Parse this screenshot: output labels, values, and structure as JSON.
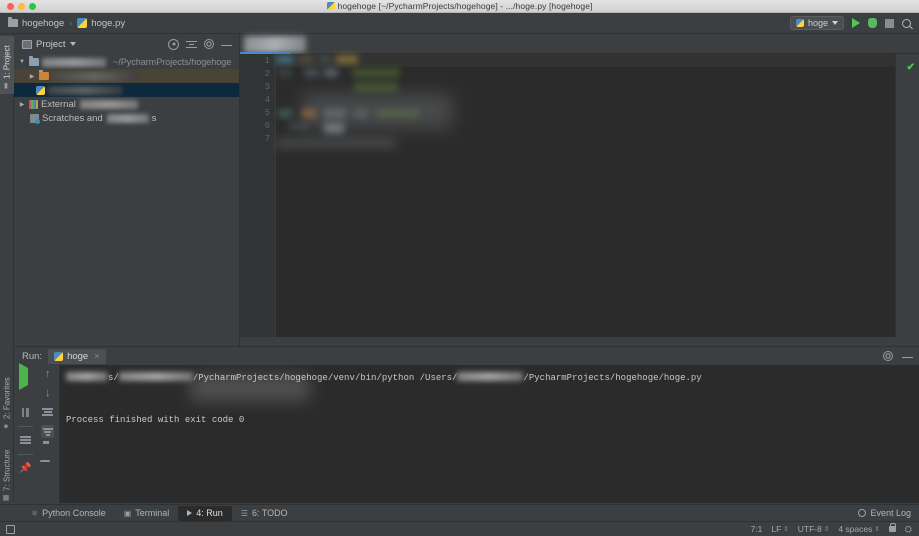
{
  "window": {
    "mac_title": "hogehoge [~/PycharmProjects/hogehoge] - .../hoge.py [hogehoge]",
    "traffic_lights": [
      "close-button",
      "minimize-button",
      "zoom-button"
    ]
  },
  "navbar": {
    "project_crumb": "hogehoge",
    "separator": "›",
    "file_crumb": "hoge.py"
  },
  "toolbar": {
    "run_config_name": "hoge",
    "run_button": "run-button",
    "debug_button": "debug-button",
    "stop_button": "stop-button",
    "search_button": "search-everywhere-button"
  },
  "vertical_tabs": [
    {
      "label": "1: Project",
      "active": true
    },
    {
      "label": "2: Favorites",
      "active": false
    },
    {
      "label": "7: Structure",
      "active": false
    }
  ],
  "project_panel": {
    "title": "Project",
    "tools": [
      "locate-icon",
      "collapse-all-icon",
      "settings-icon",
      "hide-icon"
    ],
    "tree": [
      {
        "name": "root-project-folder",
        "label": "",
        "path_hint": "~/PycharmProjects/hogehoge",
        "redacted": true,
        "indent": 0,
        "expanded": true,
        "state": "normal"
      },
      {
        "name": "venv-folder",
        "label": "",
        "path_hint": "",
        "redacted": true,
        "indent": 1,
        "expanded": false,
        "state": "highlight"
      },
      {
        "name": "python-file",
        "label": "",
        "path_hint": "",
        "redacted": true,
        "indent": 1,
        "expanded": null,
        "state": "selected"
      },
      {
        "name": "external-libraries",
        "label": "External",
        "path_hint": "",
        "redacted": true,
        "indent": 0,
        "expanded": false,
        "state": "normal"
      },
      {
        "name": "scratches-and-consoles",
        "label": "Scratches and",
        "path_hint": "",
        "redacted": true,
        "indent": 0,
        "expanded": null,
        "state": "normal"
      }
    ]
  },
  "editor": {
    "tab_redacted": true,
    "line_numbers": [
      "1",
      "2",
      "3",
      "4",
      "5",
      "6",
      "7"
    ],
    "code_redacted": true,
    "inspection_status": "ok-checkmark"
  },
  "run_panel": {
    "label": "Run:",
    "tab_name": "hoge",
    "tab_close": "×",
    "header_tools": [
      "settings-icon",
      "hide-icon"
    ],
    "left_buttons": [
      "rerun-button",
      "stop-button",
      "pause-button",
      "layout-button",
      "pin-button"
    ],
    "right_buttons": [
      "up-button",
      "down-button",
      "soft-wrap-button",
      "filter-button",
      "print-button",
      "clear-all-button"
    ],
    "console_lines": [
      {
        "prefix_redacted": true,
        "text_a": "s/",
        "redacted_mid": true,
        "text_b": "/PycharmProjects/hogehoge/venv/bin/python /Users/",
        "redacted_end": true,
        "text_c": "/PycharmProjects/hogehoge/hoge.py"
      },
      {
        "text": "Process finished with exit code 0",
        "partly_redacted": true
      }
    ]
  },
  "bottom_tabs": [
    {
      "label": "Python Console",
      "icon": "python-console-icon",
      "active": false
    },
    {
      "label": "Terminal",
      "icon": "terminal-icon",
      "active": false
    },
    {
      "label": "4: Run",
      "icon": "run-icon",
      "active": true
    },
    {
      "label": "6: TODO",
      "icon": "todo-icon",
      "active": false
    }
  ],
  "event_log": {
    "label": "Event Log"
  },
  "statusbar": {
    "caret_position": "7:1",
    "line_separator": "LF",
    "encoding": "UTF-8",
    "indent": "4 spaces",
    "lock": "read-only-toggle",
    "cart": "plugin-icon"
  },
  "colors": {
    "accent_blue": "#4a88c7",
    "selection_blue": "#0d293e",
    "editor_bg": "#2b2b2b",
    "panel_bg": "#3c3f41",
    "run_green": "#4ec94e",
    "highlight_row": "#4a4436"
  }
}
